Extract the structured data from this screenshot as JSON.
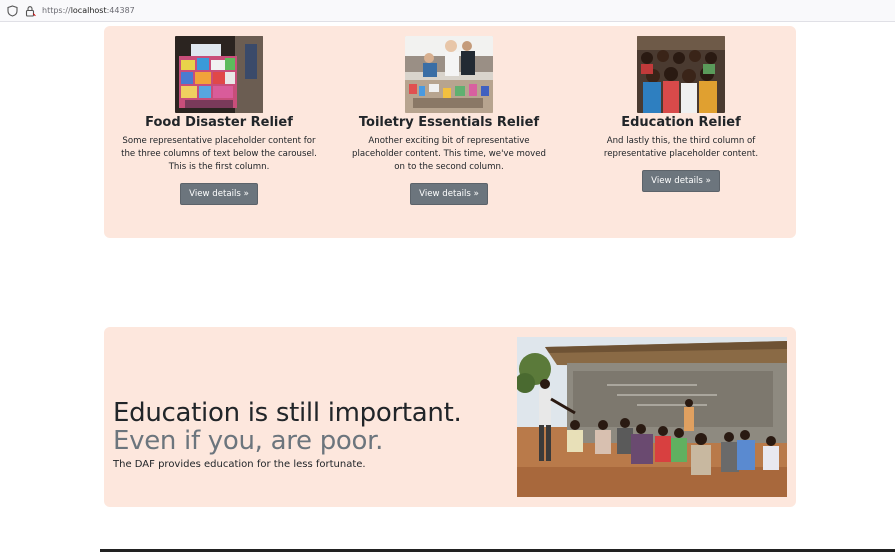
{
  "browser": {
    "url_prefix": "https://",
    "url_host": "localhost",
    "url_port": ":44387"
  },
  "columns": [
    {
      "title": "Food Disaster Relief",
      "text": "Some representative placeholder content for the three columns of text below the carousel. This is the first column.",
      "button": "View details »",
      "image": "food-relief-photo"
    },
    {
      "title": "Toiletry Essentials Relief",
      "text": "Another exciting bit of representative placeholder content. This time, we've moved on to the second column.",
      "button": "View details »",
      "image": "toiletry-relief-photo"
    },
    {
      "title": "Education Relief",
      "text": "And lastly this, the third column of representative placeholder content.",
      "button": "View details »",
      "image": "education-relief-photo"
    }
  ],
  "featurette": {
    "heading": "Education is still important.",
    "muted": "Even if you, are poor.",
    "lead": "The DAF provides education for the less fortunate.",
    "image": "outdoor-classroom-photo"
  },
  "colors": {
    "panel_bg": "#fde7dd",
    "button_bg": "#6c757d",
    "muted_text": "#6c757d"
  }
}
